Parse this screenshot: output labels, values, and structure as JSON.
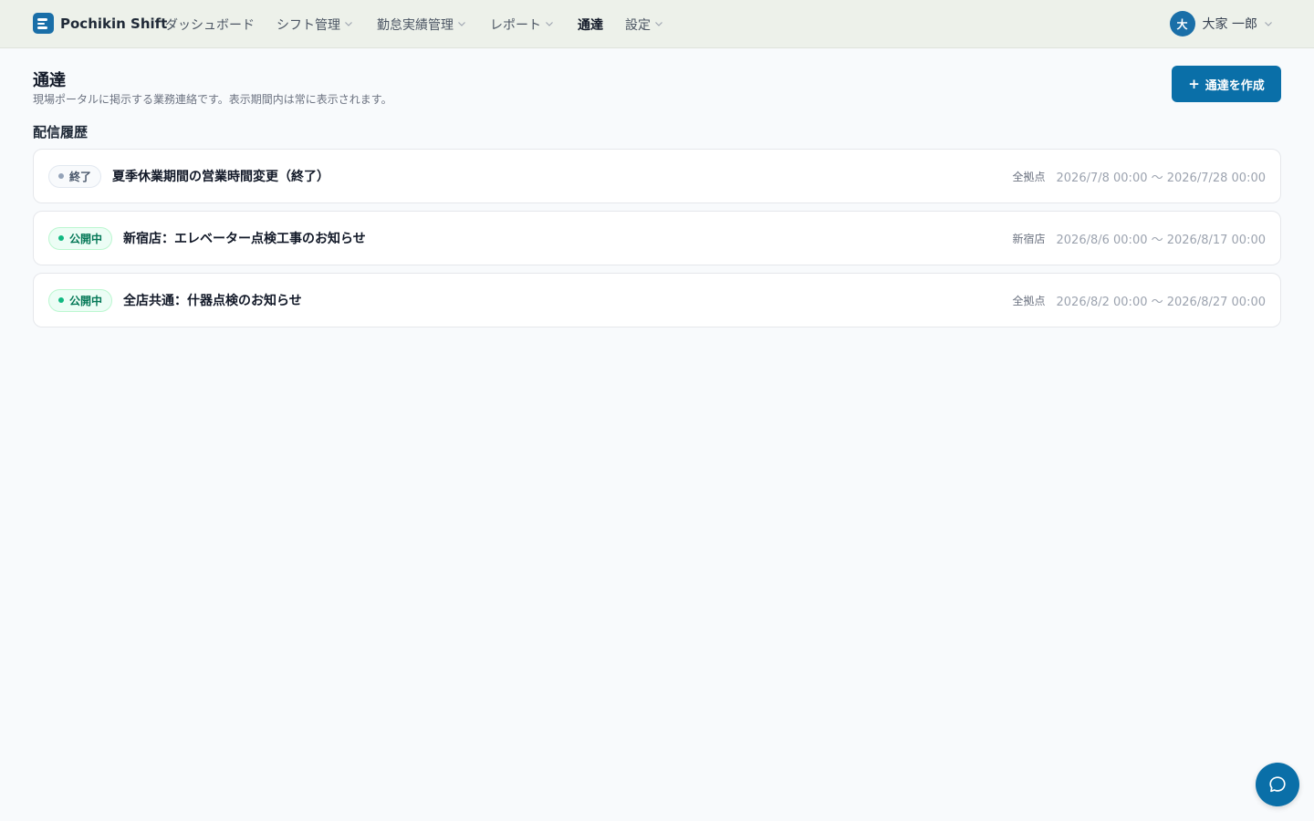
{
  "header": {
    "brand_name": "Pochikin Shift",
    "nav": [
      {
        "label": "ダッシュボード",
        "has_dropdown": false,
        "active": false
      },
      {
        "label": "シフト管理",
        "has_dropdown": true,
        "active": false
      },
      {
        "label": "勤怠実績管理",
        "has_dropdown": true,
        "active": false
      },
      {
        "label": "レポート",
        "has_dropdown": true,
        "active": false
      },
      {
        "label": "通達",
        "has_dropdown": false,
        "active": true
      },
      {
        "label": "設定",
        "has_dropdown": true,
        "active": false
      }
    ],
    "user": {
      "avatar_initial": "大",
      "name": "大家 一郎"
    }
  },
  "page": {
    "title": "通達",
    "description": "現場ポータルに掲示する業務連絡です。表示期間内は常に表示されます。",
    "create_button": {
      "icon": "plus-icon",
      "label": "通達を作成"
    },
    "section_title": "配信履歴"
  },
  "notices": [
    {
      "status": "終了",
      "status_type": "ended",
      "title": "夏季休業期間の営業時間変更（終了）",
      "site": "全拠点",
      "period": "2026/7/8 00:00 〜 2026/7/28 00:00"
    },
    {
      "status": "公開中",
      "status_type": "active",
      "title": "新宿店：エレベーター点検工事のお知らせ",
      "site": "新宿店",
      "period": "2026/8/6 00:00 〜 2026/8/17 00:00"
    },
    {
      "status": "公開中",
      "status_type": "active",
      "title": "全店共通：什器点検のお知らせ",
      "site": "全拠点",
      "period": "2026/8/2 00:00 〜 2026/8/27 00:00"
    }
  ],
  "colors": {
    "primary": "#0a6fa8",
    "header_bg": "#edf1ea",
    "active_badge": "#047857",
    "ended_badge": "#475569"
  },
  "chat_button": {
    "icon": "chat-bubble-icon"
  }
}
